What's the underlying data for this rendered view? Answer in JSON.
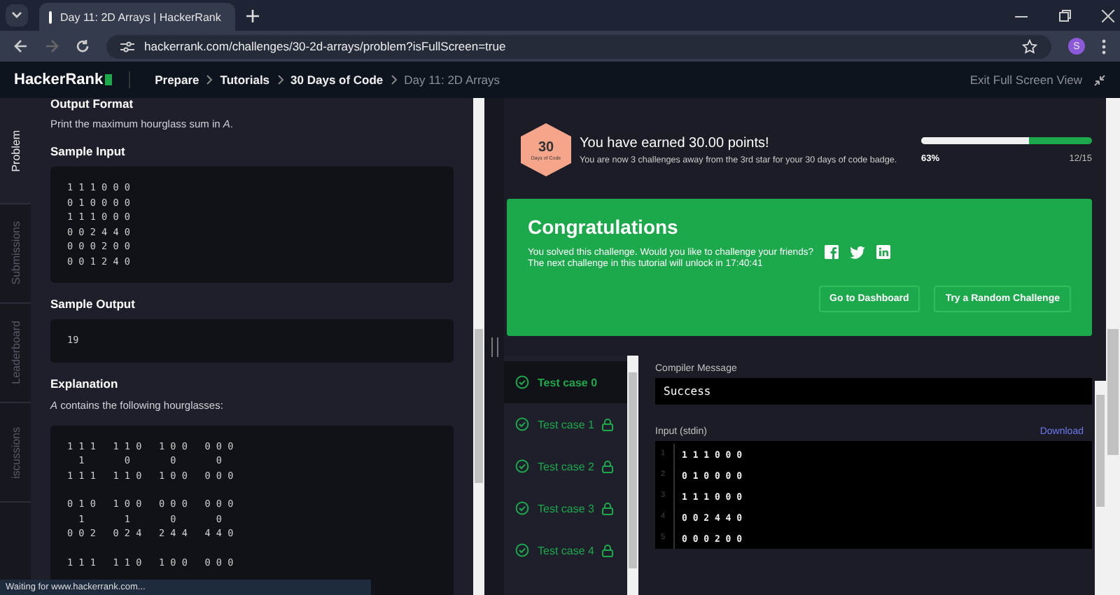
{
  "browser": {
    "tab_title": "Day 11: 2D Arrays | HackerRank",
    "url": "hackerrank.com/challenges/30-2d-arrays/problem?isFullScreen=true",
    "avatar_letter": "S"
  },
  "site_header": {
    "logo": "HackerRank",
    "breadcrumbs": [
      {
        "label": "Prepare",
        "current": false
      },
      {
        "label": "Tutorials",
        "current": false
      },
      {
        "label": "30 Days of Code",
        "current": false
      },
      {
        "label": "Day 11: 2D Arrays",
        "current": true
      }
    ],
    "exit_label": "Exit Full Screen View"
  },
  "side_tabs": [
    {
      "label": "Problem",
      "selected": true
    },
    {
      "label": "Submissions",
      "selected": false
    },
    {
      "label": "Leaderboard",
      "selected": false
    },
    {
      "label": "iscussions",
      "selected": false
    }
  ],
  "problem": {
    "output_heading": "Output Format",
    "output_text": "Print the maximum hourglass sum in *A*.",
    "sample_input_heading": "Sample Input",
    "sample_input": [
      "1 1 1 0 0 0",
      "0 1 0 0 0 0",
      "1 1 1 0 0 0",
      "0 0 2 4 4 0",
      "0 0 0 2 0 0",
      "0 0 1 2 4 0"
    ],
    "sample_output_heading": "Sample Output",
    "sample_output": "19",
    "explanation_heading": "Explanation",
    "explanation_text": "*A* contains the following hourglasses:",
    "hourglass_groups": [
      [
        "1 1 1   1 1 0   1 0 0   0 0 0",
        "  1       0       0       0",
        "1 1 1   1 1 0   1 0 0   0 0 0"
      ],
      [
        "0 1 0   1 0 0   0 0 0   0 0 0",
        "  1       1       0       0",
        "0 0 2   0 2 4   2 4 4   4 4 0"
      ],
      [
        "1 1 1   1 1 0   1 0 0   0 0 0"
      ]
    ]
  },
  "badge": {
    "number": "30",
    "caption": "Days of Code",
    "title": "You have earned 30.00 points!",
    "subtitle": "You are now 3 challenges away from the 3rd star for your 30 days of code badge.",
    "progress": {
      "level": 0.63,
      "percent_label": "63%",
      "count_label": "12/15"
    }
  },
  "congrats": {
    "title": "Congratulations",
    "text": "You solved this challenge. Would you like to challenge your friends?",
    "unlock_text": "The next challenge in this tutorial will unlock in 17:40:41",
    "buttons": [
      "Go to Dashboard",
      "Try a Random Challenge"
    ]
  },
  "test_cases": [
    {
      "label": "Test case 0",
      "selected": true,
      "locked": false
    },
    {
      "label": "Test case 1",
      "selected": false,
      "locked": true
    },
    {
      "label": "Test case 2",
      "selected": false,
      "locked": true
    },
    {
      "label": "Test case 3",
      "selected": false,
      "locked": true
    },
    {
      "label": "Test case 4",
      "selected": false,
      "locked": true
    }
  ],
  "result": {
    "compiler_label": "Compiler Message",
    "compiler_message": "Success",
    "input_label": "Input (stdin)",
    "download_label": "Download",
    "input_lines": [
      {
        "number": "1",
        "text": "1 1 1 0 0 0"
      },
      {
        "number": "2",
        "text": "0 1 0 0 0 0"
      },
      {
        "number": "3",
        "text": "1 1 1 0 0 0"
      },
      {
        "number": "4",
        "text": "0 0 2 4 4 0"
      },
      {
        "number": "5",
        "text": "0 0 0 2 0 0"
      }
    ]
  },
  "status_text": "Waiting for www.hackerrank.com..."
}
